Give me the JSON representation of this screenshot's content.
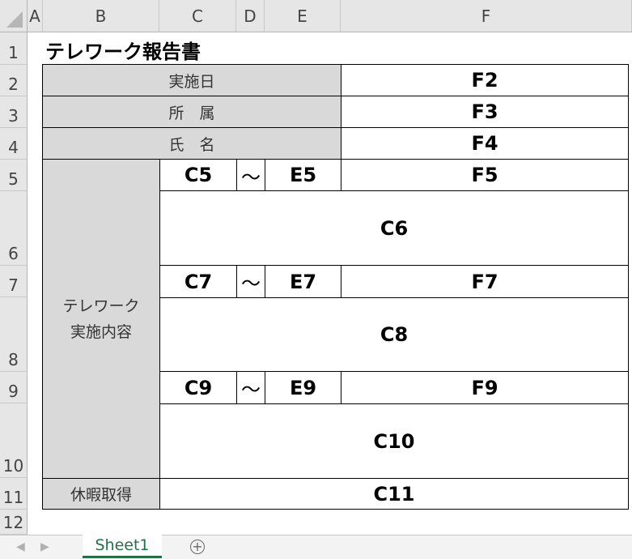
{
  "columns": [
    "A",
    "B",
    "C",
    "D",
    "E",
    "F"
  ],
  "rows": [
    "1",
    "2",
    "3",
    "4",
    "5",
    "6",
    "7",
    "8",
    "9",
    "10",
    "11",
    "12"
  ],
  "title": "テレワーク報告書",
  "labels": {
    "date": "実施日",
    "affiliation": "所　属",
    "name": "氏　名",
    "content_line1": "テレワーク",
    "content_line2": "実施内容",
    "leave": "休暇取得"
  },
  "cells": {
    "F2": "F2",
    "F3": "F3",
    "F4": "F4",
    "C5": "C5",
    "D5": "～",
    "E5": "E5",
    "F5": "F5",
    "C6": "C6",
    "C7": "C7",
    "D7": "～",
    "E7": "E7",
    "F7": "F7",
    "C8": "C8",
    "C9": "C9",
    "D9": "～",
    "E9": "E9",
    "F9": "F9",
    "C10": "C10",
    "C11": "C11"
  },
  "sheet_tabs": [
    {
      "name": "Sheet1",
      "active": true
    }
  ],
  "add_sheet_icon": "plus-circle-icon",
  "accent_color": "#217346"
}
